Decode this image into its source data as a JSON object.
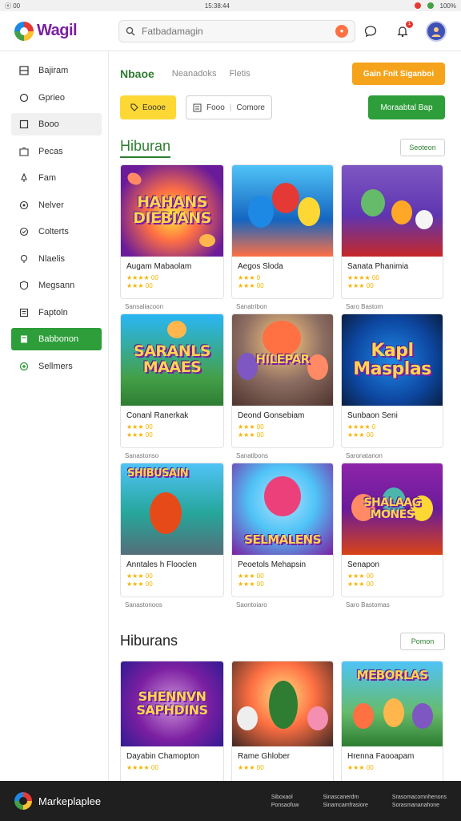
{
  "status": {
    "left": "ⓔ 00",
    "center": "15:38:44",
    "right": "100%"
  },
  "header": {
    "logo_text": "Wagil",
    "search_placeholder": "Fatbadamagin",
    "search_badge": "●",
    "notif_count": "1"
  },
  "sidebar": {
    "items": [
      {
        "label": "Bajiram",
        "icon": "grid-icon"
      },
      {
        "label": "Gprieo",
        "icon": "chat-icon"
      },
      {
        "label": "Booo",
        "icon": "square-icon"
      },
      {
        "label": "Pecas",
        "icon": "puzzle-icon"
      },
      {
        "label": "Fam",
        "icon": "pin-icon"
      },
      {
        "label": "Nelver",
        "icon": "target-icon"
      },
      {
        "label": "Colterts",
        "icon": "circle-icon"
      },
      {
        "label": "Nlaelis",
        "icon": "bulb-icon"
      },
      {
        "label": "Megsann",
        "icon": "shield-icon"
      },
      {
        "label": "Faptoln",
        "icon": "doc-icon"
      },
      {
        "label": "Babbonon",
        "icon": "bookmark-icon"
      },
      {
        "label": "Sellmers",
        "icon": "settings-icon"
      }
    ]
  },
  "tabs": {
    "active": "Nbaoe",
    "t2": "Neanadoks",
    "t3": "Fletis"
  },
  "actions": {
    "orange": "Gain  Fnit  Siganboi",
    "yellow": "Eoooe",
    "outline_a": "Fooo",
    "outline_b": "Comore",
    "green": "Moraabtal  Bap"
  },
  "section1": {
    "title": "Hiburan",
    "see_all": "Seoteon"
  },
  "section2": {
    "title": "Hiburans",
    "see_all": "Pomon"
  },
  "cards": [
    {
      "thumb": "HAHANS DIEBIANS",
      "title": "Augam Mabaolam",
      "stars": "★★★★ 00",
      "meta": "★★★ 00",
      "foot": "Sansaliacoon"
    },
    {
      "thumb": "",
      "title": "Aegos Sloda",
      "stars": "★★★ 0",
      "meta": "★★★ 00",
      "foot": "Sanatribon"
    },
    {
      "thumb": "",
      "title": "Sanata Phanimia",
      "stars": "★★★★ 00",
      "meta": "★★★ 00",
      "foot": "Saro Bastom"
    },
    {
      "thumb": "SARANLS MAAES",
      "title": "Conanl Ranerkak",
      "stars": "★★★ 00",
      "meta": "★★★ 00",
      "foot": "Sanastonso"
    },
    {
      "thumb": "HILEPAR",
      "title": "Deond Gonsebiam",
      "stars": "★★★ 00",
      "meta": "★★★ 00",
      "foot": "Sanatibons"
    },
    {
      "thumb": "Kapl Masplas",
      "title": "Sunbaon Seni",
      "stars": "★★★★ 0",
      "meta": "★★★ 00",
      "foot": "Saronatanon"
    },
    {
      "thumb": "SHIBUSAIN",
      "title": "Anntales h Flooclen",
      "stars": "★★★ 00",
      "meta": "★★★ 00",
      "foot": "Sanastonoos"
    },
    {
      "thumb": "SELMALENS",
      "title": "Peoetols Mehapsin",
      "stars": "★★★ 00",
      "meta": "★★★ 00",
      "foot": "Saontoiaro"
    },
    {
      "thumb": "SHALAAG MONES",
      "title": "Senapon",
      "stars": "★★★ 00",
      "meta": "★★★ 00",
      "foot": "Saro Bastomas"
    },
    {
      "thumb": "SHENNVN SAPHDINS",
      "title": "Dayabin Chamopton",
      "stars": "★★★★ 00",
      "meta": "",
      "foot": ""
    },
    {
      "thumb": "",
      "title": "Rame Ghlober",
      "stars": "★★★ 00",
      "meta": "",
      "foot": ""
    },
    {
      "thumb": "MEBORLAS",
      "title": "Hrenna Faooapam",
      "stars": "★★★ 00",
      "meta": "",
      "foot": ""
    }
  ],
  "footer": {
    "name": "Markeplaplee",
    "col1": [
      "Siboxaol",
      "Ponsaofuw"
    ],
    "col2": [
      "Sinascanerdm",
      "Sinamcamfrasiore"
    ],
    "col3": [
      "Srasomacomnhenons",
      "Sorasmananahone"
    ]
  },
  "colors": {
    "brand_green": "#2e9e3a",
    "orange": "#f5a31a",
    "yellow": "#fdd835"
  }
}
